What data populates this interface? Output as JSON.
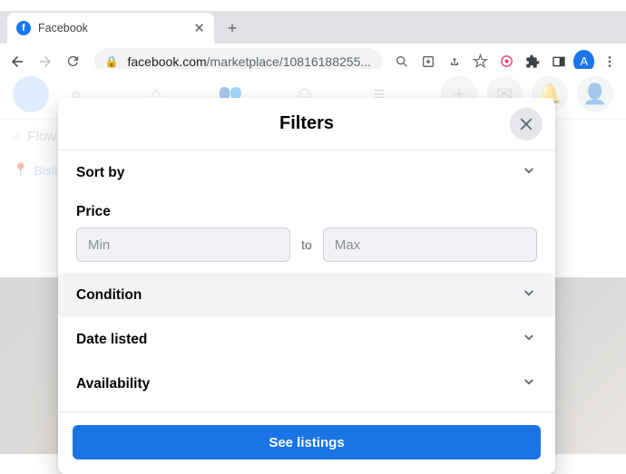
{
  "window": {
    "tab_title": "Facebook",
    "url_domain": "facebook.com",
    "url_path": "/marketplace/10816188255...",
    "avatar_letter": "A"
  },
  "page": {
    "search_placeholder": "Flow",
    "location_text": "Bisli"
  },
  "modal": {
    "title": "Filters",
    "sort_label": "Sort by",
    "price_label": "Price",
    "min_placeholder": "Min",
    "to_label": "to",
    "max_placeholder": "Max",
    "condition_label": "Condition",
    "date_label": "Date listed",
    "availability_label": "Availability",
    "submit_label": "See listings"
  }
}
